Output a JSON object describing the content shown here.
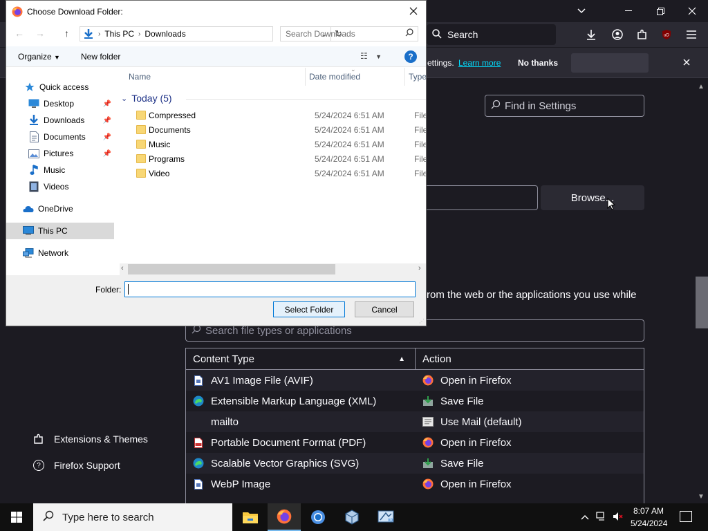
{
  "browser": {
    "search_placeholder": "Search",
    "notification": {
      "text": "ettings.",
      "link": "Learn more",
      "dismiss_button": "No thanks"
    },
    "find_in_settings_placeholder": "Find in Settings",
    "browse_button": "Browse...",
    "applications_description": "rom the web or the applications you use while",
    "applications_search_placeholder": "Search file types or applications",
    "content_table": {
      "headers": [
        "Content Type",
        "Action"
      ],
      "rows": [
        {
          "type": "AV1 Image File (AVIF)",
          "type_icon": "file-icon",
          "action": "Open in Firefox",
          "action_icon": "firefox-icon"
        },
        {
          "type": "Extensible Markup Language (XML)",
          "type_icon": "edge-icon",
          "action": "Save File",
          "action_icon": "save-icon"
        },
        {
          "type": "mailto",
          "type_icon": "",
          "action": "Use Mail (default)",
          "action_icon": "mail-icon"
        },
        {
          "type": "Portable Document Format (PDF)",
          "type_icon": "pdf-icon",
          "action": "Open in Firefox",
          "action_icon": "firefox-icon"
        },
        {
          "type": "Scalable Vector Graphics (SVG)",
          "type_icon": "edge-icon",
          "action": "Save File",
          "action_icon": "save-icon"
        },
        {
          "type": "WebP Image",
          "type_icon": "file-icon",
          "action": "Open in Firefox",
          "action_icon": "firefox-icon"
        }
      ]
    },
    "sidebar_links": [
      "Extensions & Themes",
      "Firefox Support"
    ]
  },
  "dialog": {
    "title": "Choose Download Folder:",
    "breadcrumb": [
      "This PC",
      "Downloads"
    ],
    "search_placeholder": "Search Downloads",
    "toolbar": {
      "organize": "Organize",
      "new_folder": "New folder"
    },
    "nav_items": [
      {
        "label": "Quick access",
        "icon": "star-icon"
      },
      {
        "label": "Desktop",
        "icon": "desktop-icon",
        "pinned": true
      },
      {
        "label": "Downloads",
        "icon": "download-icon",
        "pinned": true
      },
      {
        "label": "Documents",
        "icon": "documents-icon",
        "pinned": true
      },
      {
        "label": "Pictures",
        "icon": "pictures-icon",
        "pinned": true
      },
      {
        "label": "Music",
        "icon": "music-icon"
      },
      {
        "label": "Videos",
        "icon": "videos-icon"
      },
      {
        "label": "OneDrive",
        "icon": "cloud-icon"
      },
      {
        "label": "This PC",
        "icon": "computer-icon",
        "selected": true
      },
      {
        "label": "Network",
        "icon": "network-icon"
      }
    ],
    "columns": [
      "Name",
      "Date modified",
      "Type"
    ],
    "group_label": "Today (5)",
    "files": [
      {
        "name": "Compressed",
        "date": "5/24/2024 6:51 AM",
        "type": "File fo"
      },
      {
        "name": "Documents",
        "date": "5/24/2024 6:51 AM",
        "type": "File fo"
      },
      {
        "name": "Music",
        "date": "5/24/2024 6:51 AM",
        "type": "File fo"
      },
      {
        "name": "Programs",
        "date": "5/24/2024 6:51 AM",
        "type": "File fo"
      },
      {
        "name": "Video",
        "date": "5/24/2024 6:51 AM",
        "type": "File fo"
      }
    ],
    "folder_label": "Folder:",
    "folder_value": "",
    "select_button": "Select Folder",
    "cancel_button": "Cancel"
  },
  "taskbar": {
    "search_placeholder": "Type here to search",
    "apps": [
      "file-explorer-icon",
      "firefox-icon",
      "chrome-icon",
      "virtualbox-icon",
      "xp-app-icon"
    ],
    "time": "8:07 AM",
    "date": "5/24/2024"
  },
  "colors": {
    "firefox_bg": "#1c1b22",
    "firefox_surface": "#2b2a33",
    "link": "#00ddff",
    "dialog_accent": "#0078d7",
    "taskbar": "#101010"
  }
}
